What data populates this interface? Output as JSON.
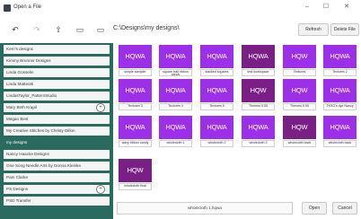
{
  "window": {
    "title": "Open a File",
    "minimize": "–",
    "maximize": "☐",
    "close": "✕"
  },
  "toolbar": {
    "path": "C:\\Designs\\my designs\\",
    "refresh_label": "Refresh",
    "delete_label": "Delete File",
    "icons": [
      "undo-icon",
      "redo-icon",
      "up-arrow-icon",
      "view-icon",
      "view-icon-2"
    ]
  },
  "sidebar": {
    "items": [
      "Kerri's designs",
      "Kimmy Brunner Designs",
      "Linda Gosselin",
      "Linda Matteotti",
      "LindasTaylor_PatternStudio",
      "Mary Beth Krapil",
      "Megan Best",
      "My Creative Stitches by Christy Dillon",
      "my designs",
      "Nancy Haacke Designs",
      "One Song Needle Arts by Donna Kleinke",
      "Pam Clarke",
      "PS Designs",
      "PSD Transfer"
    ],
    "selected": "my designs",
    "expander_symbol": "+"
  },
  "files": [
    {
      "thumb": "HQWA",
      "caption": "simple sampler",
      "color": "#9c2fe8"
    },
    {
      "thumb": "HQWA",
      "caption": "square trail ribbon candy",
      "color": "#9c2fe8"
    },
    {
      "thumb": "HQWA",
      "caption": "stacked squares",
      "color": "#9c2fe8"
    },
    {
      "thumb": "HQWA",
      "caption": "test workspace",
      "color": "#7a1f86"
    },
    {
      "thumb": "HQW",
      "caption": "Textures",
      "color": "#9c2fe8"
    },
    {
      "thumb": "HQWA",
      "caption": "Textures 2",
      "color": "#9c2fe8"
    },
    {
      "thumb": "HQWA",
      "caption": "Textures 3",
      "color": "#9c2fe8"
    },
    {
      "thumb": "HQWA",
      "caption": "Textures 4",
      "color": "#9c2fe8"
    },
    {
      "thumb": "HQWA",
      "caption": "Textures 5",
      "color": "#9c2fe8"
    },
    {
      "thumb": "HQW",
      "caption": "Themes 0.05",
      "color": "#7a1f86"
    },
    {
      "thumb": "HQW",
      "caption": "Themes 0.05",
      "color": "#9c2fe8"
    },
    {
      "thumb": "HQWA",
      "caption": "TKSG's dye Nancy",
      "color": "#9c2fe8"
    },
    {
      "thumb": "HQWA",
      "caption": "wavy ribbon candy",
      "color": "#9c2fe8"
    },
    {
      "thumb": "HQWA",
      "caption": "wholecloth 1",
      "color": "#9c2fe8"
    },
    {
      "thumb": "HQWA",
      "caption": "wholecloth 2",
      "color": "#9c2fe8"
    },
    {
      "thumb": "HQWA",
      "caption": "wholecloth 3",
      "color": "#9c2fe8"
    },
    {
      "thumb": "HQW",
      "caption": "wholecloth back",
      "color": "#7a1f86"
    },
    {
      "thumb": "HQWA",
      "caption": "wholecloth back",
      "color": "#9c2fe8"
    },
    {
      "thumb": "HQW",
      "caption": "wholecloth final",
      "color": "#7a1f86"
    }
  ],
  "bottom": {
    "filename": "wholecloth 1.hqwa",
    "open_label": "Open",
    "cancel_label": "Cancel"
  }
}
